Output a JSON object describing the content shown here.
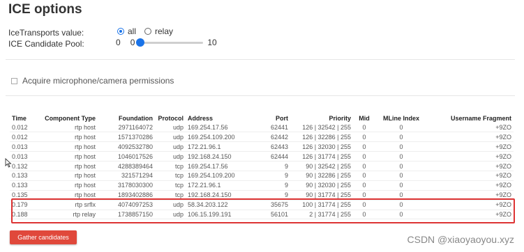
{
  "page": {
    "title": "ICE options"
  },
  "options": {
    "transports_label": "IceTransports value:",
    "transports": [
      {
        "label": "all",
        "checked": true
      },
      {
        "label": "relay",
        "checked": false
      }
    ],
    "pool_label": "ICE Candidate Pool:",
    "pool_value": "0",
    "pool_min": "0",
    "pool_max": "10",
    "acquire_label": "Acquire microphone/camera permissions"
  },
  "table": {
    "headers": [
      "Time",
      "Component Type",
      "Foundation",
      "Protocol",
      "Address",
      "Port",
      "Priority",
      "Mid",
      "MLine Index",
      "Username Fragment"
    ],
    "rows": [
      [
        "0.012",
        "rtp host",
        "2971164072",
        "udp",
        "169.254.17.56",
        "62441",
        "126 | 32542 | 255",
        "0",
        "0",
        "+9ZO"
      ],
      [
        "0.012",
        "rtp host",
        "1571370286",
        "udp",
        "169.254.109.200",
        "62442",
        "126 | 32286 | 255",
        "0",
        "0",
        "+9ZO"
      ],
      [
        "0.013",
        "rtp host",
        "4092532780",
        "udp",
        "172.21.96.1",
        "62443",
        "126 | 32030 | 255",
        "0",
        "0",
        "+9ZO"
      ],
      [
        "0.013",
        "rtp host",
        "1046017526",
        "udp",
        "192.168.24.150",
        "62444",
        "126 | 31774 | 255",
        "0",
        "0",
        "+9ZO"
      ],
      [
        "0.132",
        "rtp host",
        "4288389464",
        "tcp",
        "169.254.17.56",
        "9",
        "90 | 32542 | 255",
        "0",
        "0",
        "+9ZO"
      ],
      [
        "0.133",
        "rtp host",
        "321571294",
        "tcp",
        "169.254.109.200",
        "9",
        "90 | 32286 | 255",
        "0",
        "0",
        "+9ZO"
      ],
      [
        "0.133",
        "rtp host",
        "3178030300",
        "tcp",
        "172.21.96.1",
        "9",
        "90 | 32030 | 255",
        "0",
        "0",
        "+9ZO"
      ],
      [
        "0.135",
        "rtp host",
        "1893402886",
        "tcp",
        "192.168.24.150",
        "9",
        "90 | 31774 | 255",
        "0",
        "0",
        "+9ZO"
      ],
      [
        "0.179",
        "rtp srflx",
        "4074097253",
        "udp",
        "58.34.203.122",
        "35675",
        "100 | 31774 | 255",
        "0",
        "0",
        "+9ZO"
      ],
      [
        "0.188",
        "rtp relay",
        "1738857150",
        "udp",
        "106.15.199.191",
        "56101",
        "2 | 31774 | 255",
        "0",
        "0",
        "+9ZO"
      ]
    ]
  },
  "gather_button": "Gather candidates",
  "watermark": "CSDN @xiaoyaoyou.xyz"
}
